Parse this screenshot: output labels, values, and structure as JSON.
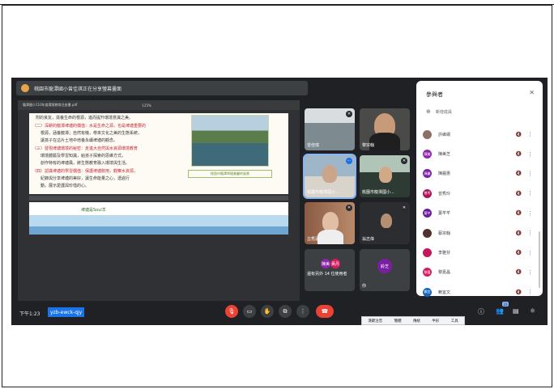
{
  "banner": {
    "text": "桃園市龍潭國小曾佳琪正在分享螢幕畫面"
  },
  "shared_doc": {
    "filename": "龍潭國小110年度環境教育白皮書.pdf",
    "zoom": "125%",
    "lines": [
      "附的良友，滋養生命的根源，進而提升環境意識之美。",
      "（二）深耕的龍潭埤塘的價值：水是生命之源，也是埤塘重要的",
      "根源，涵養龍潭；自然有機，帶來文化之美的生態系統，",
      "讓孩子在這片土地中培養永續埤塘的觀念。",
      "（三）發現埤塘環境的秘密：走進大自然與水資源環境教育",
      "環境體驗及學習知識，給孩子探索的思維方式，",
      "創作特有的埤塘風，將生態教育融入環境與生活。",
      "（四）認識埤塘的學習價值：保護埤塘飲用，觀察水資源，",
      "紀錄與分享埤塘的美好，讓生命能量之心，透過行",
      "動，展示愛護與珍惜的心。"
    ],
    "photo_caption": "桃園市龍潭埤塘美麗的風景",
    "page2_text": "埤塘是Soul羊"
  },
  "tiles": [
    {
      "name": "曾佳琪",
      "muted": true
    },
    {
      "name": "黎宗翰",
      "muted": true
    },
    {
      "name": "桃園市龍潭國小...",
      "muted": false
    },
    {
      "name": "桃園市龍潭國小...",
      "muted": false
    },
    {
      "name": "古秀蓮",
      "muted": true
    },
    {
      "name": "翁志偉",
      "muted": true
    },
    {
      "name": "還有另外 14 位使用者",
      "avatars": [
        "陳美",
        "黃丹"
      ]
    },
    {
      "name": "你",
      "avatar": "鈴芝"
    }
  ],
  "panel": {
    "title": "參與者",
    "add_label": "新增成員",
    "participants": [
      {
        "name": "許維綱",
        "initial": "",
        "color": "#8d6e63",
        "photo": true
      },
      {
        "name": "陳美芝",
        "initial": "陳美",
        "color": "#8e24aa"
      },
      {
        "name": "陳麗惠",
        "initial": "陳麗",
        "color": "#7b1fa2"
      },
      {
        "name": "曾秀玲",
        "initial": "曾秀",
        "color": "#ad1457"
      },
      {
        "name": "葉芊芊",
        "initial": "葉芊",
        "color": "#6a1b9a"
      },
      {
        "name": "蔡宗翰",
        "initial": "",
        "color": "#4e342e",
        "photo": true
      },
      {
        "name": "李雅芬",
        "initial": "",
        "color": "#c2185b"
      },
      {
        "name": "黎嘉晶",
        "initial": "黎嘉",
        "color": "#d81b60"
      },
      {
        "name": "賴宜文",
        "initial": "賴宜",
        "color": "#1565c0"
      }
    ]
  },
  "bottom": {
    "time": "下午1:23",
    "meeting_code": "yzb-ewck-qjy",
    "participant_count": "23"
  },
  "taskbar": [
    "漢鍵注音",
    "簡體",
    "傳統",
    "半形",
    "工具"
  ]
}
